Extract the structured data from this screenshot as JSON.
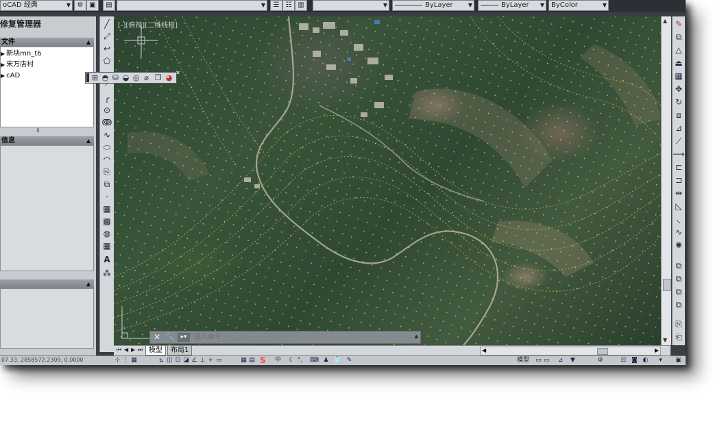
{
  "toolbar": {
    "workspace": "oCAD 经典",
    "layer_value": "",
    "color_value": "",
    "linetype": "ByLayer",
    "lineweight": "ByLayer",
    "plotstyle": "ByColor"
  },
  "palette": {
    "title": "修复管理器",
    "files_header": "文件",
    "files": [
      "新块mn_t6",
      "宋万店村",
      "cAD"
    ],
    "details_header": "信息"
  },
  "viewport": {
    "label": "[-][俯视][二维线框]"
  },
  "command": {
    "placeholder": "键入命令"
  },
  "tabs": [
    "模型",
    "布局1"
  ],
  "status": {
    "coords": "07.33, 2858572.2309, 0.0000",
    "model_label": "模型"
  },
  "colors": {
    "accent": "#f0e24a",
    "canvas_bg": "#2f4832"
  }
}
